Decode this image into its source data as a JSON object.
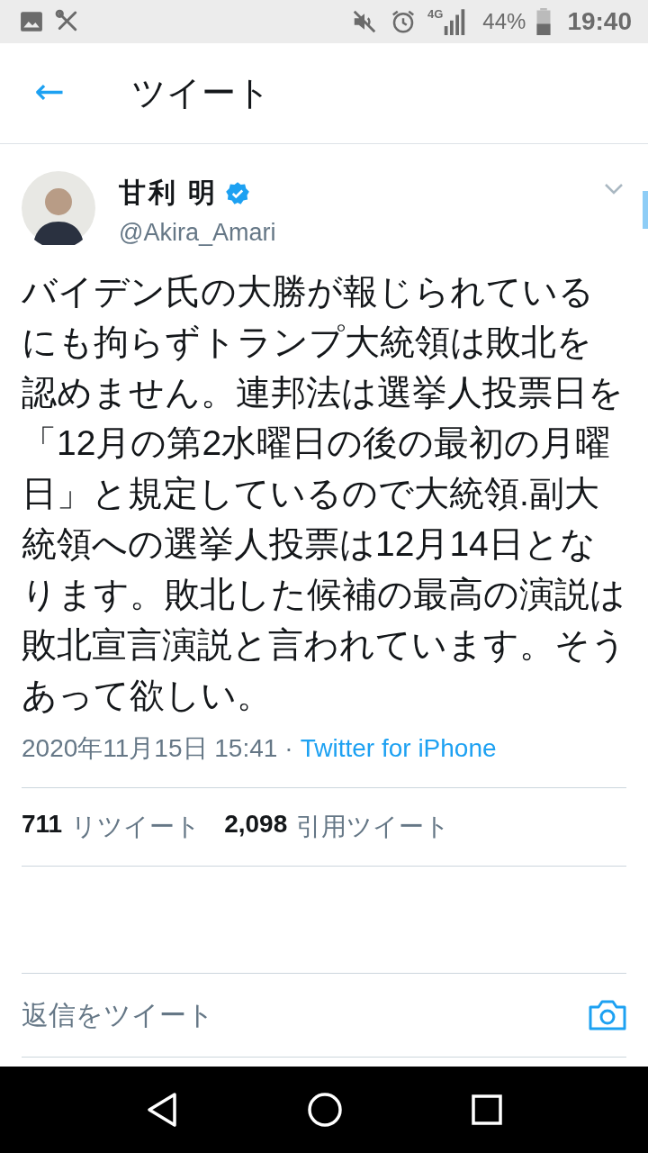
{
  "status_bar": {
    "battery": "44%",
    "time": "19:40",
    "network": "4G"
  },
  "header": {
    "back": "←",
    "title": "ツイート"
  },
  "tweet": {
    "author": "甘利 明",
    "verified": true,
    "handle": "@Akira_Amari",
    "text": "バイデン氏の大勝が報じられているにも拘らずトランプ大統領は敗北を認めません。連邦法は選挙人投票日を「12月の第2水曜日の後の最初の月曜日」と規定しているので大統領.副大統領への選挙人投票は12月14日となります。敗北した候補の最高の演説は敗北宣言演説と言われています。そうあって欲しい。",
    "timestamp": "2020年11月15日 15:41",
    "separator": "·",
    "source": "Twitter for iPhone"
  },
  "stats": [
    {
      "count": "711",
      "label": "リツイート"
    },
    {
      "count": "2,098",
      "label": "引用ツイート"
    }
  ],
  "reply": {
    "placeholder": "返信をツイート"
  }
}
